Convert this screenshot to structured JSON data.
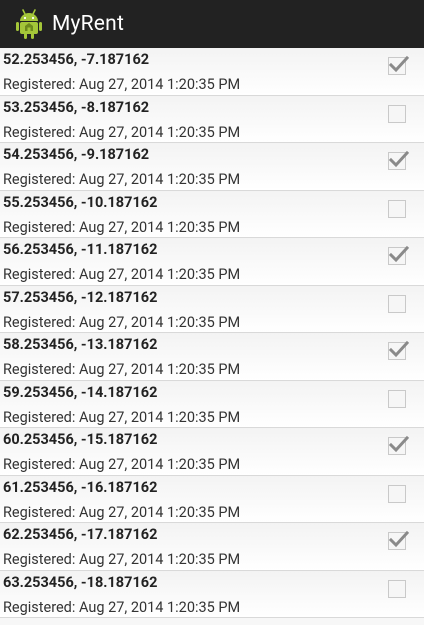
{
  "app": {
    "title": "MyRent",
    "icon": "android-robot-icon"
  },
  "residences": [
    {
      "geolocation": "52.253456, -7.187162",
      "date": "Registered: Aug 27, 2014 1:20:35 PM",
      "rented": true
    },
    {
      "geolocation": "53.253456, -8.187162",
      "date": "Registered: Aug 27, 2014 1:20:35 PM",
      "rented": false
    },
    {
      "geolocation": "54.253456, -9.187162",
      "date": "Registered: Aug 27, 2014 1:20:35 PM",
      "rented": true
    },
    {
      "geolocation": "55.253456, -10.187162",
      "date": "Registered: Aug 27, 2014 1:20:35 PM",
      "rented": false
    },
    {
      "geolocation": "56.253456, -11.187162",
      "date": "Registered: Aug 27, 2014 1:20:35 PM",
      "rented": true
    },
    {
      "geolocation": "57.253456, -12.187162",
      "date": "Registered: Aug 27, 2014 1:20:35 PM",
      "rented": false
    },
    {
      "geolocation": "58.253456, -13.187162",
      "date": "Registered: Aug 27, 2014 1:20:35 PM",
      "rented": true
    },
    {
      "geolocation": "59.253456, -14.187162",
      "date": "Registered: Aug 27, 2014 1:20:35 PM",
      "rented": false
    },
    {
      "geolocation": "60.253456, -15.187162",
      "date": "Registered: Aug 27, 2014 1:20:35 PM",
      "rented": true
    },
    {
      "geolocation": "61.253456, -16.187162",
      "date": "Registered: Aug 27, 2014 1:20:35 PM",
      "rented": false
    },
    {
      "geolocation": "62.253456, -17.187162",
      "date": "Registered: Aug 27, 2014 1:20:35 PM",
      "rented": true
    },
    {
      "geolocation": "63.253456, -18.187162",
      "date": "Registered: Aug 27, 2014 1:20:35 PM",
      "rented": false
    }
  ],
  "colors": {
    "action_bar": "#222222",
    "android_green": "#a4c639",
    "check_mark": "#8a8a8a"
  }
}
